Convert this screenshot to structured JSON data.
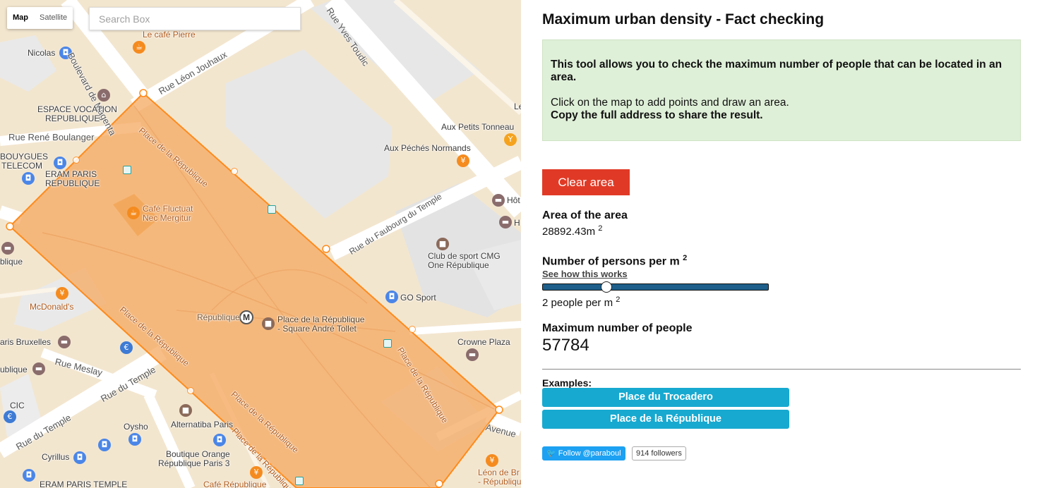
{
  "map": {
    "type_control": {
      "map": "Map",
      "satellite": "Satellite"
    },
    "search_placeholder": "Search Box",
    "colors": {
      "polygon_fill": "#f6a860",
      "polygon_stroke": "#ff8a1a",
      "road": "#ffffff",
      "block": "#f3e6cf",
      "building": "#e6e6e6"
    },
    "labels": {
      "le_cafe_pierre": "Le café Pierre",
      "boulevard_magenta": "Boulevard de Magenta",
      "rue_yves_toudic": "Rue Yves Toudic",
      "nicolas": "Nicolas",
      "rue_leon_jouhaux": "Rue Léon Jouhaux",
      "espace_vocation_1": "ESPACE VOCATION",
      "espace_vocation_2": "REPUBLIQUE",
      "rue_rene_boulanger": "Rue René Boulanger",
      "bouygues_1": "BOUYGUES",
      "bouygues_2": "TELECOM",
      "eram_1": "ERAM PARIS",
      "eram_2": "REPUBLIQUE",
      "place_rep_1": "Place de la République",
      "place_rep_2": "Place de la République",
      "place_rep_3": "Place de la République",
      "place_rep_4": "Place de la République",
      "place_rep_5": "Place de la République",
      "aux_petits": "Aux Petits Tonneau",
      "aux_peches": "Aux Péchés Normands",
      "le_edge": "Le",
      "cafe_fluctuat_1": "Café Fluctuat",
      "cafe_fluctuat_2": "Nec Mergitur",
      "hot": "Hôt",
      "h_edge": "H",
      "rue_faubourg": "Rue du Faubourg du Temple",
      "club_sport_1": "Club de sport CMG",
      "club_sport_2": "One République",
      "blique": "blique",
      "go_sport": "GO Sport",
      "republique_metro": "République",
      "place_square_1": "Place de la République",
      "place_square_2": "- Square André Tollet",
      "mcdonalds": "McDonald's",
      "crowne": "Crowne Plaza",
      "aris_bruxelles": "aris Bruxelles",
      "rue_meslay": "Rue Meslay",
      "rue_du_temple_1": "Rue du Temple",
      "ublique": "ublique",
      "cic": "CIC",
      "rue_du_temple_2": "Rue du Temple",
      "oysho": "Oysho",
      "alternatiba": "Alternatiba Paris",
      "avenue": "Avenue",
      "boutique_1": "Boutique Orange",
      "boutique_2": "République Paris 3",
      "cyrillus": "Cyrillus",
      "leon_1": "Léon de Br",
      "leon_2": "- République",
      "eram_temple": "ERAM PARIS TEMPLE",
      "cafe_rep": "Café République"
    }
  },
  "panel": {
    "title": "Maximum urban density - Fact checking",
    "info_line1": "This tool allows you to check the maximum number of people that can be located in an area.",
    "info_line2": "Click on the map to add points and draw an area.",
    "info_line3": "Copy the full address to share the result.",
    "clear_button": "Clear area",
    "area_label": "Area of the area",
    "area_value": "28892.43m",
    "area_exp": "2",
    "persons_label": "Number of persons per m",
    "persons_exp": "2",
    "how_link": "See how this works",
    "slider_value": 2,
    "slider_text": "2 people per m",
    "slider_exp": "2",
    "max_label": "Maximum number of people",
    "max_value": "57784",
    "examples_label": "Examples:",
    "examples": [
      "Place du Trocadero",
      "Place de la République"
    ],
    "twitter_follow": "Follow @paraboul",
    "twitter_followers": "914 followers"
  }
}
